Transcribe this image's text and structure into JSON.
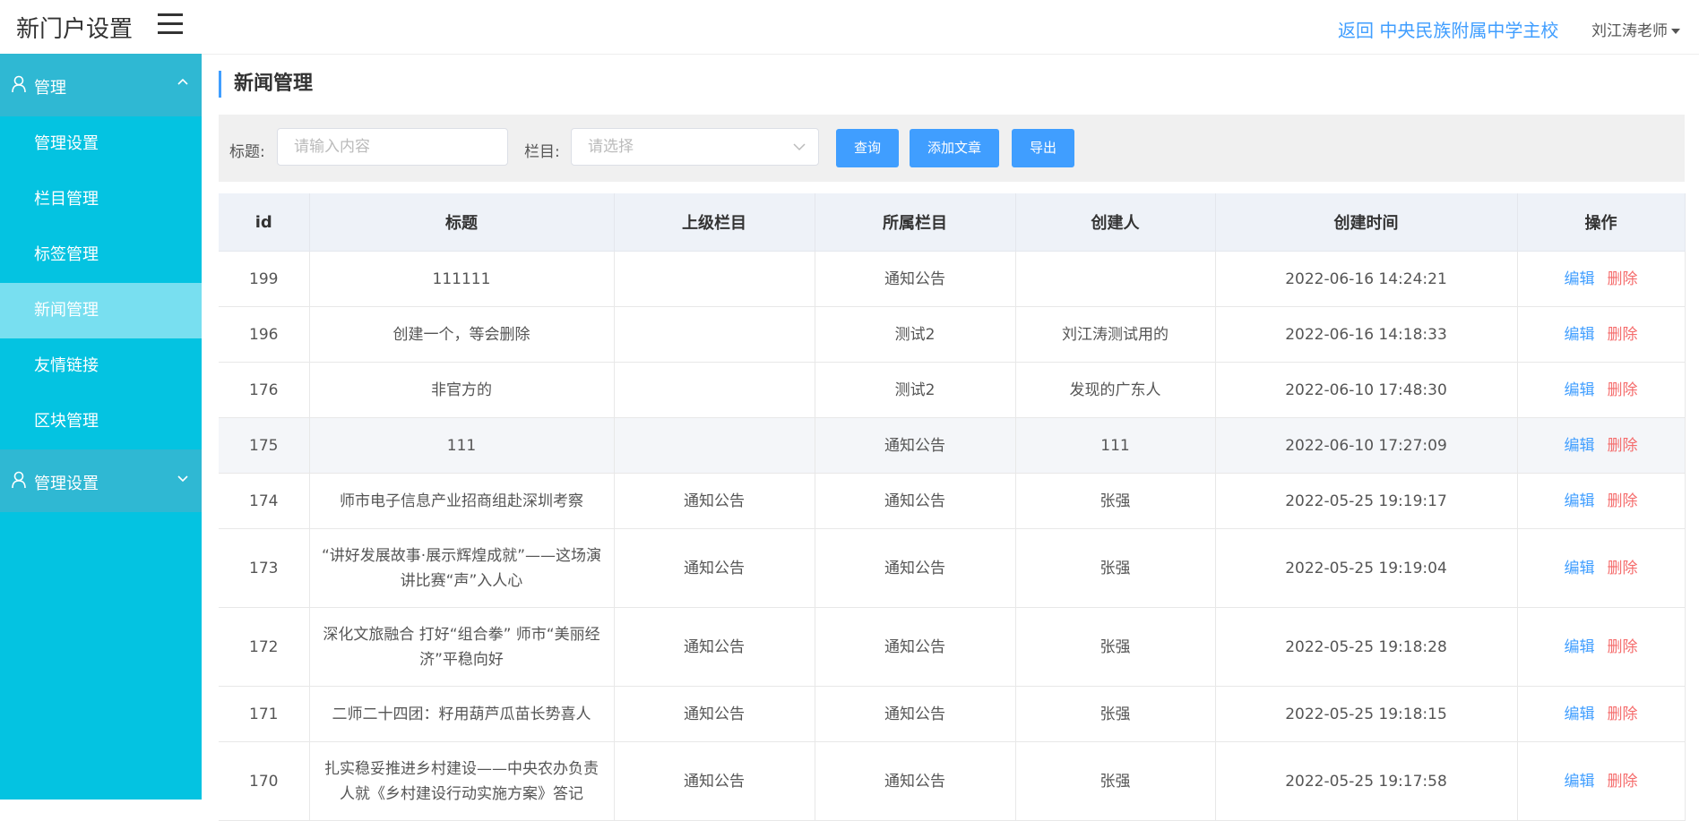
{
  "header": {
    "app_title": "新门户设置",
    "back_link": "返回 中央民族附属中学主校",
    "user": "刘江涛老师"
  },
  "sidebar": {
    "group1": "管理",
    "items": [
      "管理设置",
      "栏目管理",
      "标签管理",
      "新闻管理",
      "友情链接",
      "区块管理"
    ],
    "active_index": 3,
    "group2": "管理设置"
  },
  "page": {
    "title": "新闻管理"
  },
  "filter": {
    "title_label": "标题:",
    "title_placeholder": "请输入内容",
    "column_label": "栏目:",
    "column_placeholder": "请选择",
    "query_button": "查询",
    "add_button": "添加文章",
    "export_button": "导出"
  },
  "table": {
    "headers": [
      "id",
      "标题",
      "上级栏目",
      "所属栏目",
      "创建人",
      "创建时间",
      "操作"
    ],
    "edit_label": "编辑",
    "delete_label": "删除",
    "rows": [
      {
        "id": "199",
        "title": "111111",
        "parent": "",
        "column": "通知公告",
        "creator": "",
        "time": "2022-06-16 14:24:21"
      },
      {
        "id": "196",
        "title": "创建一个，等会删除",
        "parent": "",
        "column": "测试2",
        "creator": "刘江涛测试用的",
        "time": "2022-06-16 14:18:33"
      },
      {
        "id": "176",
        "title": "非官方的",
        "parent": "",
        "column": "测试2",
        "creator": "发现的广东人",
        "time": "2022-06-10 17:48:30"
      },
      {
        "id": "175",
        "title": "111",
        "parent": "",
        "column": "通知公告",
        "creator": "111",
        "time": "2022-06-10 17:27:09"
      },
      {
        "id": "174",
        "title": "师市电子信息产业招商组赴深圳考察",
        "parent": "通知公告",
        "column": "通知公告",
        "creator": "张强",
        "time": "2022-05-25 19:19:17"
      },
      {
        "id": "173",
        "title": "“讲好发展故事·展示辉煌成就”——这场演讲比赛“声”入人心",
        "parent": "通知公告",
        "column": "通知公告",
        "creator": "张强",
        "time": "2022-05-25 19:19:04"
      },
      {
        "id": "172",
        "title": "深化文旅融合 打好“组合拳” 师市“美丽经济”平稳向好",
        "parent": "通知公告",
        "column": "通知公告",
        "creator": "张强",
        "time": "2022-05-25 19:18:28"
      },
      {
        "id": "171",
        "title": "二师二十四团：籽用葫芦瓜苗长势喜人",
        "parent": "通知公告",
        "column": "通知公告",
        "creator": "张强",
        "time": "2022-05-25 19:18:15"
      },
      {
        "id": "170",
        "title": "扎实稳妥推进乡村建设——中央农办负责人就《乡村建设行动实施方案》答记",
        "parent": "通知公告",
        "column": "通知公告",
        "creator": "张强",
        "time": "2022-05-25 19:17:58"
      }
    ]
  },
  "colors": {
    "sidebar": "#04c3e1",
    "primary": "#409eff",
    "danger": "#f56c6c"
  }
}
